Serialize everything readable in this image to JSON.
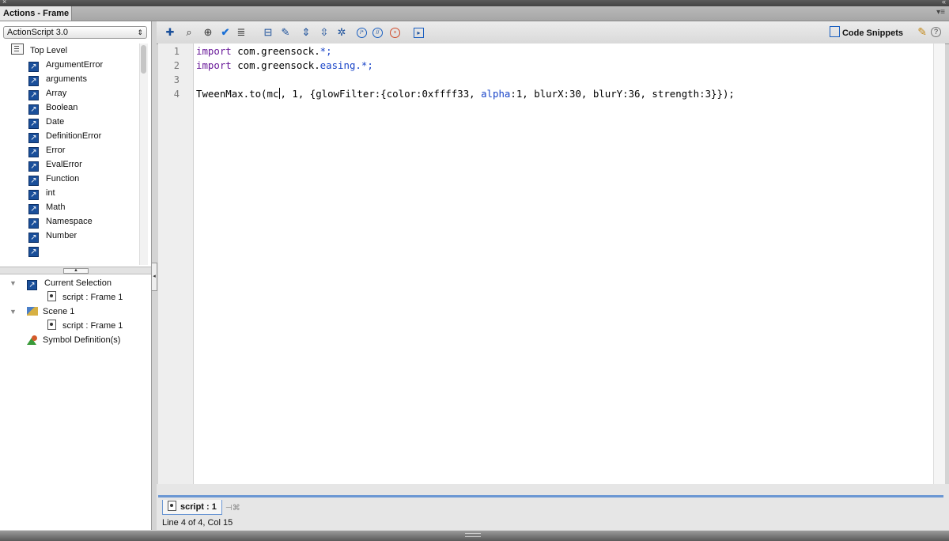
{
  "window": {
    "panel_tab": "Actions - Frame"
  },
  "left_panel": {
    "language_select": "ActionScript 3.0",
    "library_root": "Top Level",
    "library_items": [
      "ArgumentError",
      "arguments",
      "Array",
      "Boolean",
      "Date",
      "DefinitionError",
      "Error",
      "EvalError",
      "Function",
      "int",
      "Math",
      "Namespace",
      "Number"
    ],
    "tree": {
      "current_selection": "Current Selection",
      "current_script": "script : Frame 1",
      "scene": "Scene 1",
      "scene_script": "script : Frame 1",
      "symbols": "Symbol Definition(s)"
    }
  },
  "toolbar": {
    "icons": [
      "add-new-item-icon",
      "find-icon",
      "insert-target-path-icon",
      "check-syntax-icon",
      "auto-format-icon",
      "show-code-hint-icon",
      "debug-options-icon",
      "collapse-between-braces-icon",
      "collapse-selection-icon",
      "expand-all-icon",
      "apply-block-comment-icon",
      "apply-line-comment-icon",
      "remove-comment-icon",
      "show-hide-toolbox-icon"
    ],
    "code_snippets_label": "Code Snippets"
  },
  "editor": {
    "line_numbers": [
      "1",
      "2",
      "3",
      "4"
    ],
    "lines": {
      "l1_kw": "import",
      "l1_pkg": " com.greensock.",
      "l1_rest": "*;",
      "l2_kw": "import",
      "l2_pkg_a": " com.greensock.",
      "l2_pkg_b": "easing.",
      "l2_rest": "*;",
      "l4_a": "TweenMax.to(mc",
      "l4_b": ", 1, {glowFilter:{color:0xffff33, ",
      "l4_alpha": "alpha",
      "l4_c": ":1, blurX:30, blurY:36, strength:3}});"
    }
  },
  "bottom": {
    "script_tab": "script : 1",
    "status": "Line 4 of 4, Col 15"
  }
}
